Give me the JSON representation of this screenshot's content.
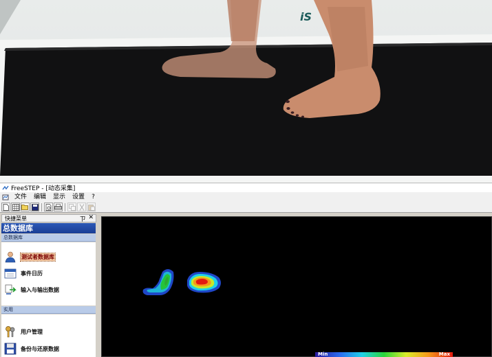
{
  "photo": {
    "brand_text": "iS"
  },
  "window": {
    "title": "FreeSTEP - [动态采集]"
  },
  "menu": {
    "items": [
      "文件",
      "编辑",
      "显示",
      "设置",
      "?"
    ]
  },
  "toolbar": {
    "buttons": [
      "new-doc-icon",
      "grid-icon",
      "open-folder-icon",
      "save-icon",
      "print-preview-icon",
      "print-icon",
      "copy-icon",
      "cut-icon",
      "paste-icon"
    ]
  },
  "sidebar": {
    "panel_title": "快捷菜单",
    "pin_glyph": "ㄗ",
    "close_glyph": "✕",
    "db_title": "总数据库",
    "group1": {
      "label": "总数据库",
      "items": [
        {
          "label": "测试者数据库",
          "icon": "user-icon",
          "selected": true
        },
        {
          "label": "事件日历",
          "icon": "calendar-icon",
          "selected": false
        },
        {
          "label": "输入与输出数据",
          "icon": "import-export-icon",
          "selected": false
        }
      ]
    },
    "group2": {
      "label": "实用",
      "items": [
        {
          "label": "用户管理",
          "icon": "keys-icon"
        },
        {
          "label": "备份与还原数据",
          "icon": "floppy-disk-icon"
        }
      ]
    }
  },
  "display": {
    "colorbar": {
      "min_label": "Min",
      "max_label": "Max"
    }
  }
}
